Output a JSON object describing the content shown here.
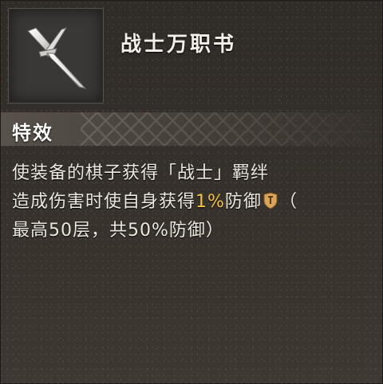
{
  "item": {
    "name": "战士万职书",
    "icon": "crossed-swords-emblem-icon"
  },
  "section": {
    "title": "特效"
  },
  "description": {
    "line1": "使装备的棋子获得「战士」羁绊",
    "line2_pre": "造成伤害时使自身获得",
    "line2_highlight": "1%",
    "line2_post": "防御",
    "line2_tail": "（",
    "line3": "最高50层，共50%防御）",
    "stat_icon": "armor-shield-icon"
  },
  "colors": {
    "highlight": "#f2c24a",
    "text": "#ece8df",
    "title": "#f3f0ea"
  }
}
